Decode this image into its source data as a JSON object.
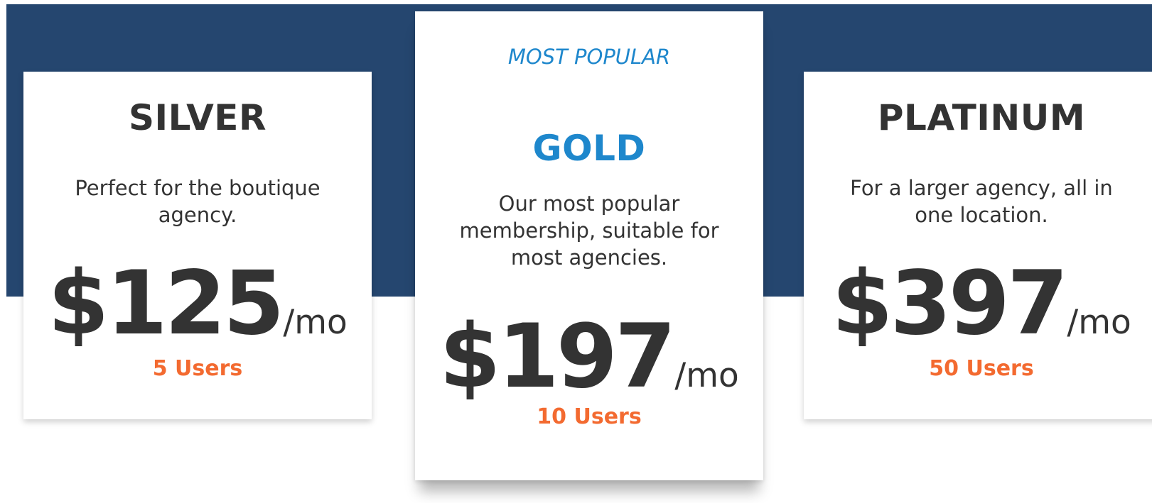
{
  "plans": {
    "silver": {
      "name": "SILVER",
      "description": "Perfect for the boutique agency.",
      "price": "$125",
      "period": "/mo",
      "users": "5 Users"
    },
    "gold": {
      "ribbon": "MOST POPULAR",
      "name": "GOLD",
      "description": "Our most popular membership, suitable for most agencies.",
      "price": "$197",
      "period": "/mo",
      "users": "10 Users"
    },
    "platinum": {
      "name": "PLATINUM",
      "description": "For a larger agency, all in one location.",
      "price": "$397",
      "period": "/mo",
      "users": "50 Users"
    }
  },
  "colors": {
    "band": "#25466f",
    "accent_blue": "#1e87cc",
    "accent_orange": "#f36a30",
    "text_dark": "#333333"
  }
}
